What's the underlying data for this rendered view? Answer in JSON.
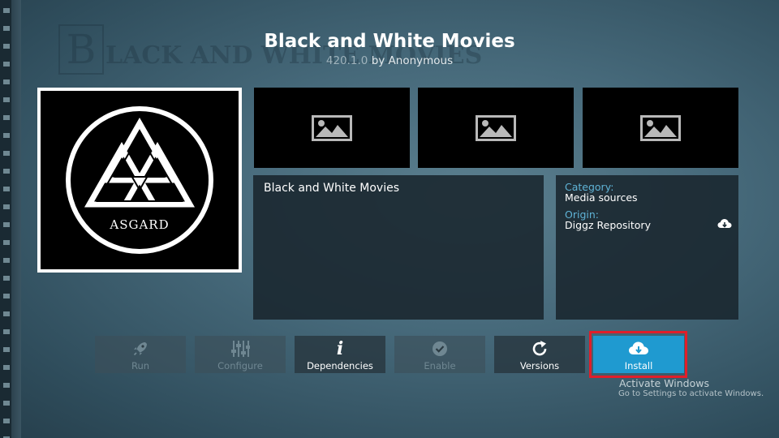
{
  "addon": {
    "name": "Black and White Movies",
    "version": "420.1.0",
    "author_line": "by Anonymous"
  },
  "fanart_logo": {
    "letter": "B",
    "text": "LACK AND WHITE MOVIES"
  },
  "icon": {
    "label": "ASGARD"
  },
  "screenshots": [
    {
      "icon": "image-placeholder-icon"
    },
    {
      "icon": "image-placeholder-icon"
    },
    {
      "icon": "image-placeholder-icon"
    }
  ],
  "description": "Black and White Movies",
  "info": {
    "category_label": "Category:",
    "category_value": "Media sources",
    "origin_label": "Origin:",
    "origin_value": "Diggz Repository"
  },
  "buttons": [
    {
      "label": "Run",
      "icon": "rocket-icon",
      "enabled": false
    },
    {
      "label": "Configure",
      "icon": "sliders-icon",
      "enabled": false
    },
    {
      "label": "Dependencies",
      "icon": "info-icon",
      "enabled": true
    },
    {
      "label": "Enable",
      "icon": "check-circle-icon",
      "enabled": false
    },
    {
      "label": "Versions",
      "icon": "refresh-icon",
      "enabled": true
    },
    {
      "label": "Install",
      "icon": "cloud-download-icon",
      "enabled": true,
      "focused": true
    }
  ],
  "watermark": {
    "line1": "Activate Windows",
    "line2": "Go to Settings to activate Windows."
  },
  "colors": {
    "accent": "#1f9ad0",
    "label_blue": "#5fb3d6",
    "highlight_red": "#e01e2a"
  }
}
